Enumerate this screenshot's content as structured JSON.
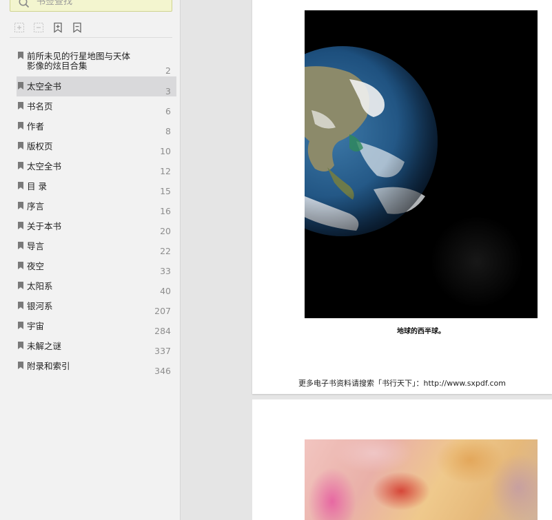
{
  "sidebar": {
    "search_placeholder": "书签查找",
    "toolbar": {
      "expand_title": "expand",
      "collapse_title": "collapse",
      "add_title": "add",
      "remove_title": "remove"
    },
    "bookmarks": [
      {
        "label": "前所未见的行星地图与天体\n影像的炫目合集",
        "page": "2"
      },
      {
        "label": "太空全书",
        "page": "3"
      },
      {
        "label": "书名页",
        "page": "6"
      },
      {
        "label": "作者",
        "page": "8"
      },
      {
        "label": "版权页",
        "page": "10"
      },
      {
        "label": "太空全书",
        "page": "12"
      },
      {
        "label": "目  录",
        "page": "15"
      },
      {
        "label": "序言",
        "page": "16"
      },
      {
        "label": "关于本书",
        "page": "20"
      },
      {
        "label": "导言",
        "page": "22"
      },
      {
        "label": "夜空",
        "page": "33"
      },
      {
        "label": "太阳系",
        "page": "40"
      },
      {
        "label": "银河系",
        "page": "207"
      },
      {
        "label": "宇宙",
        "page": "284"
      },
      {
        "label": "未解之谜",
        "page": "337"
      },
      {
        "label": "附录和索引",
        "page": "346"
      }
    ],
    "selected_index": 1
  },
  "document": {
    "page1": {
      "caption": "地球的西半球。",
      "footer": "更多电子书资料请搜索「书行天下」：http://www.sxpdf.com"
    }
  },
  "colors": {
    "sidebar_bg": "#f2f2f2",
    "selected_bg": "#d9d9db",
    "search_bg": "#f3f5cf",
    "viewer_bg": "#e5e5e5"
  }
}
